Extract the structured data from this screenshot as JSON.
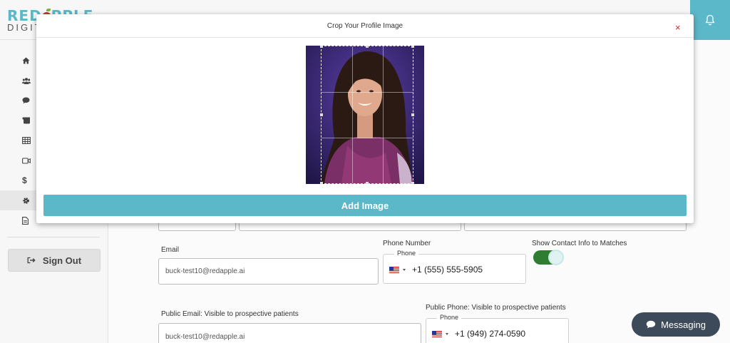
{
  "brand": {
    "line1a": "RED",
    "line1b": "PPLE",
    "line2": "DIGITAL"
  },
  "sidebar": {
    "items": [
      {
        "icon": "home-icon"
      },
      {
        "icon": "users-icon"
      },
      {
        "icon": "chat-icon"
      },
      {
        "icon": "scroll-icon"
      },
      {
        "icon": "table-icon"
      },
      {
        "icon": "video-icon"
      },
      {
        "icon": "dollar-icon"
      },
      {
        "icon": "gear-icon",
        "active": true
      },
      {
        "icon": "document-icon"
      }
    ],
    "signout_label": "Sign Out"
  },
  "form": {
    "email_label": "Email",
    "email_value": "buck-test10@redapple.ai",
    "phone_label": "Phone Number",
    "phone_legend": "Phone",
    "phone_value": "+1 (555) 555-5905",
    "show_contact_label": "Show Contact Info to Matches",
    "show_contact_on": true,
    "public_email_label": "Public Email: Visible to prospective patients",
    "public_email_value": "buck-test10@redapple.ai",
    "public_phone_label": "Public Phone: Visible to prospective patients",
    "public_phone_legend": "Phone",
    "public_phone_value": "+1 (949) 274-0590"
  },
  "modal": {
    "title": "Crop Your Profile Image",
    "close_glyph": "×",
    "add_button": "Add Image"
  },
  "messaging": {
    "label": "Messaging"
  },
  "colors": {
    "accent": "#5bb8c9",
    "toggle_on": "#2e7d32",
    "close": "#c62828",
    "messaging_bg": "#3d4a5a"
  }
}
